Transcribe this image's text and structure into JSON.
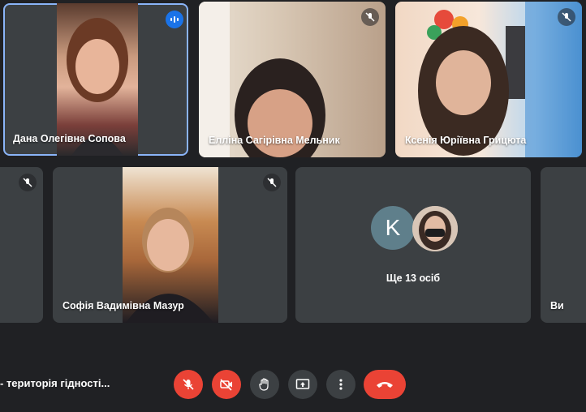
{
  "participants": [
    {
      "name": "Дана Олегівна Сопова",
      "state": "speaking"
    },
    {
      "name": "Елліна Сагірівна Мельник",
      "state": "muted"
    },
    {
      "name": "Ксенія Юріївна Грицюта",
      "state": "muted"
    },
    {
      "name": "",
      "state": "muted"
    },
    {
      "name": "Софія Вадимівна Мазур",
      "state": "muted"
    },
    {
      "name": "Ви",
      "state": "self"
    }
  ],
  "others": {
    "avatar_letter": "K",
    "label": "Ще 13 осіб"
  },
  "meeting": {
    "title": "- територія гідності..."
  },
  "controls": {
    "mic": "mic-off-icon",
    "camera": "camera-off-icon",
    "hand": "raise-hand-icon",
    "present": "present-screen-icon",
    "more": "more-vert-icon",
    "hangup": "hang-up-icon"
  },
  "colors": {
    "accent": "#1a73e8",
    "danger": "#ea4335",
    "tile": "#3c4043",
    "background": "#202124"
  }
}
